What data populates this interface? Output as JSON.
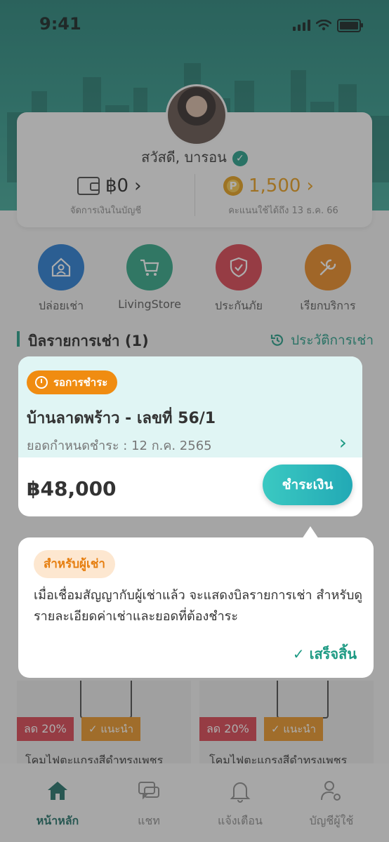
{
  "status_bar": {
    "time": "9:41"
  },
  "profile": {
    "greeting": "สวัสดี, บารอน",
    "wallet_amount": "฿0",
    "wallet_chevron": "›",
    "wallet_label": "จัดการเงินในบัญชี",
    "points_amount": "1,500",
    "points_chevron": "›",
    "points_label": "คะแนนใช้ได้ถึง 13 ธ.ค. 66",
    "coin_letter": "P"
  },
  "menu": [
    {
      "label": "ปล่อยเช่า",
      "icon": "house-person-icon",
      "color": "#1f78d1"
    },
    {
      "label": "LivingStore",
      "icon": "cart-icon",
      "color": "#2aa382"
    },
    {
      "label": "ประกันภัย",
      "icon": "shield-check-icon",
      "color": "#d83d4b"
    },
    {
      "label": "เรียกบริการ",
      "icon": "wrench-icon",
      "color": "#e8851a"
    }
  ],
  "bills_section": {
    "title": "บิลรายการเช่า (1)",
    "history_link": "ประวัติการเช่า"
  },
  "bill": {
    "status": "รอการชำระ",
    "name": "บ้านลาดพร้าว - เลขที่ 56/1",
    "due": "ยอดกำหนดชำระ : 12 ก.ค. 2565",
    "amount": "฿48,000",
    "pay_label": "ชำระเงิน"
  },
  "tooltip": {
    "tag": "สำหรับผู้เช่า",
    "text": "เมื่อเชื่อมสัญญากับผู้เช่าแล้ว จะแสดงบิลรายการเช่า สำหรับดูรายละเอียดค่าเช่าและยอดที่ต้องชำระ",
    "done": "✓ เสร็จสิ้น"
  },
  "products": [
    {
      "discount": "ลด 20%",
      "badge": "✓ แนะนำ",
      "name": "โคมไฟตะแกรงสีดำทรงเพชร"
    },
    {
      "discount": "ลด 20%",
      "badge": "✓ แนะนำ",
      "name": "โคมไฟตะแกรงสีดำทรงเพชร"
    }
  ],
  "tabs": [
    {
      "label": "หน้าหลัก",
      "icon": "home-icon",
      "active": true
    },
    {
      "label": "แชท",
      "icon": "chat-icon",
      "active": false
    },
    {
      "label": "แจ้งเตือน",
      "icon": "bell-icon",
      "active": false
    },
    {
      "label": "บัญชีผู้ใช้",
      "icon": "user-settings-icon",
      "active": false
    }
  ],
  "colors": {
    "accent": "#1d9a83",
    "orange": "#f08c11"
  }
}
